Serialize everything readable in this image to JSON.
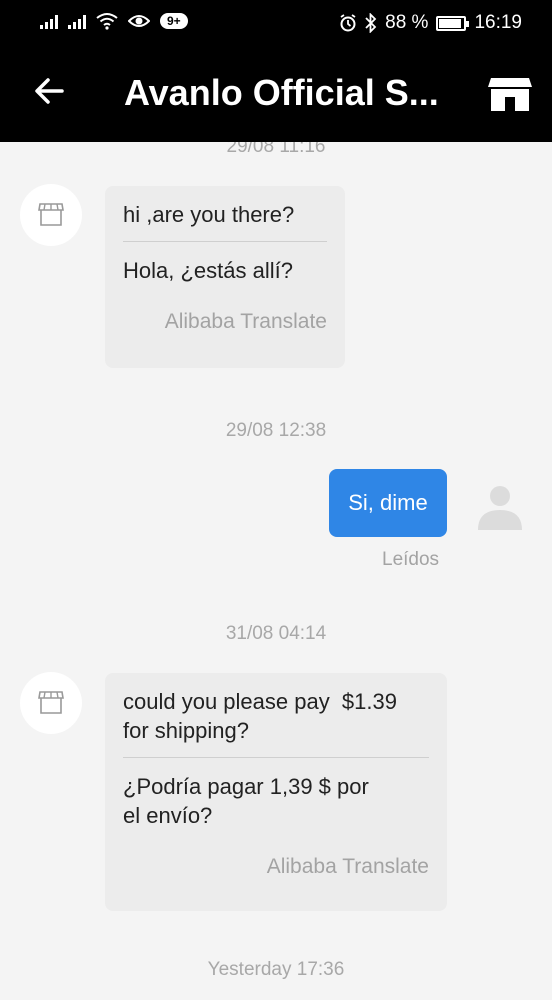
{
  "status_bar": {
    "notification_count": "9+",
    "battery": "88 %",
    "time": "16:19"
  },
  "header": {
    "title": "Avanlo Official S..."
  },
  "messages": [
    {
      "timestamp": "29/08 11:16"
    },
    {
      "original": "hi ,are you there?",
      "translation": "Hola, ¿estás allí?",
      "translator": "Alibaba Translate"
    },
    {
      "timestamp": "29/08 12:38",
      "sent_text": "Si, dime",
      "status": "Leídos"
    },
    {
      "timestamp": "31/08 04:14",
      "original_line1": "could you please pay  $1.39",
      "original_line2": "for shipping?",
      "translation_line1": "¿Podría pagar 1,39 $ por",
      "translation_line2": "el envío?",
      "translator": "Alibaba Translate"
    },
    {
      "timestamp": "Yesterday 17:36"
    }
  ],
  "colors": {
    "header_bg": "#000000",
    "sent_bubble": "#2f86e6",
    "received_bubble": "#ececec",
    "chat_bg": "#f4f4f4"
  }
}
